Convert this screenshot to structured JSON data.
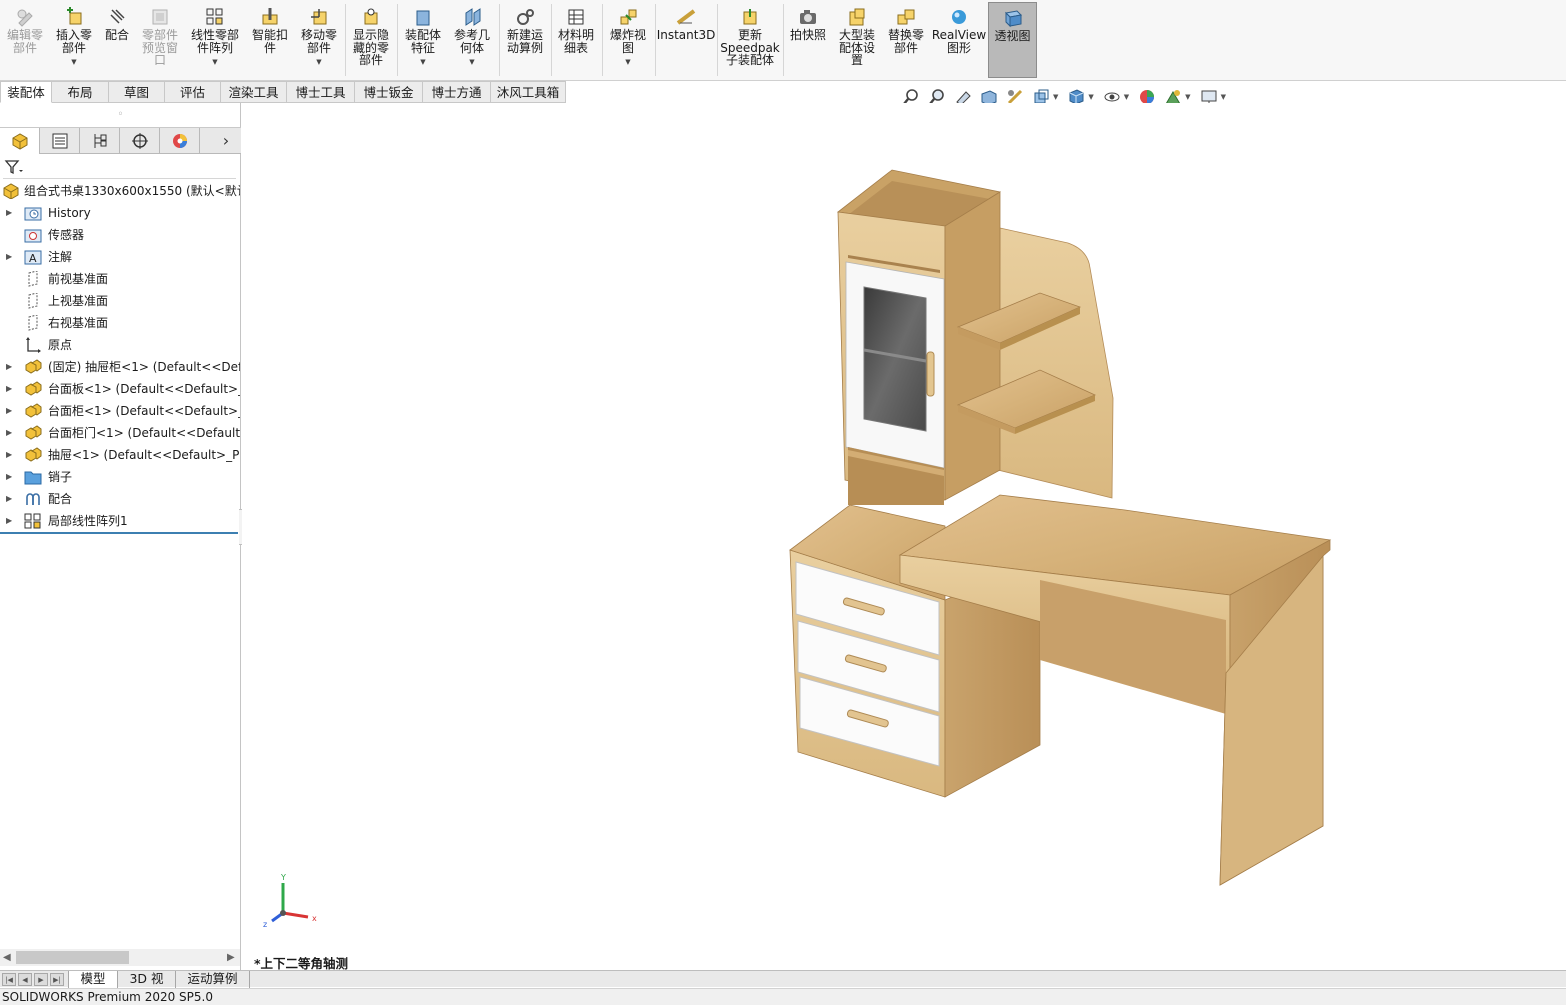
{
  "ribbon": {
    "items": [
      {
        "label": "编辑零\n部件",
        "icon": "edit-component-icon",
        "disabled": true
      },
      {
        "label": "插入零\n部件",
        "icon": "insert-components-icon",
        "dropdown": true
      },
      {
        "label": "配合",
        "icon": "mate-icon"
      },
      {
        "label": "零部件\n预览窗\n口",
        "icon": "component-preview-icon",
        "disabled": true
      },
      {
        "label": "线性零部\n件阵列",
        "icon": "linear-pattern-icon",
        "dropdown": true
      },
      {
        "label": "智能扣\n件",
        "icon": "smart-fasteners-icon"
      },
      {
        "label": "移动零\n部件",
        "icon": "move-component-icon",
        "dropdown": true
      },
      {
        "label": "显示隐\n藏的零\n部件",
        "icon": "show-hidden-icon"
      },
      {
        "label": "装配体\n特征",
        "icon": "assembly-features-icon",
        "dropdown": true
      },
      {
        "label": "参考几\n何体",
        "icon": "reference-geometry-icon",
        "dropdown": true
      },
      {
        "label": "新建运\n动算例",
        "icon": "new-motion-study-icon"
      },
      {
        "label": "材料明\n细表",
        "icon": "bom-icon"
      },
      {
        "label": "爆炸视\n图",
        "icon": "exploded-view-icon",
        "dropdown": true
      },
      {
        "label": "Instant3D",
        "icon": "instant3d-icon"
      },
      {
        "label": "更新\nSpeedpak\n子装配体",
        "icon": "speedpak-icon"
      },
      {
        "label": "拍快照",
        "icon": "snapshot-icon"
      },
      {
        "label": "大型装\n配体设\n置",
        "icon": "large-assembly-icon"
      },
      {
        "label": "替换零\n部件",
        "icon": "replace-components-icon"
      },
      {
        "label": "RealView\n图形",
        "icon": "realview-icon"
      },
      {
        "label": "透视图",
        "icon": "perspective-icon",
        "active": true
      }
    ]
  },
  "tabs": [
    "装配体",
    "布局",
    "草图",
    "评估",
    "渲染工具",
    "博士工具",
    "博士钣金",
    "博士方通",
    "沐风工具箱"
  ],
  "tree": {
    "root": "组合式书桌1330x600x1550  (默认<默认",
    "nodes": [
      {
        "label": "History",
        "icon": "history-folder-icon",
        "expand": true
      },
      {
        "label": "传感器",
        "icon": "sensors-icon",
        "expand": false
      },
      {
        "label": "注解",
        "icon": "annotations-icon",
        "expand": true
      },
      {
        "label": "前视基准面",
        "icon": "plane-icon",
        "expand": false
      },
      {
        "label": "上视基准面",
        "icon": "plane-icon",
        "expand": false
      },
      {
        "label": "右视基准面",
        "icon": "plane-icon",
        "expand": false
      },
      {
        "label": "原点",
        "icon": "origin-icon",
        "expand": false
      },
      {
        "label": "(固定) 抽屉柜<1> (Default<<Defa",
        "icon": "subassembly-icon",
        "expand": true
      },
      {
        "label": "台面板<1> (Default<<Default>_P",
        "icon": "subassembly-icon",
        "expand": true
      },
      {
        "label": "台面柜<1> (Default<<Default>_P",
        "icon": "subassembly-icon",
        "expand": true
      },
      {
        "label": "台面柜门<1> (Default<<Default>",
        "icon": "subassembly-icon",
        "expand": true
      },
      {
        "label": "抽屉<1> (Default<<Default>_Pho",
        "icon": "subassembly-icon",
        "expand": true
      },
      {
        "label": "销子",
        "icon": "folder-icon",
        "expand": true
      },
      {
        "label": "配合",
        "icon": "mates-icon",
        "expand": true
      },
      {
        "label": "局部线性阵列1",
        "icon": "local-pattern-icon",
        "expand": true
      }
    ]
  },
  "viewport": {
    "view_label": "*上下二等角轴测",
    "triad": {
      "x": "x",
      "y": "Y",
      "z": "z"
    }
  },
  "bottom_tabs": [
    "模型",
    "3D 视图",
    "运动算例 1"
  ],
  "status": "SOLIDWORKS Premium 2020 SP5.0",
  "colors": {
    "wood": "#d9b784",
    "wood_dark": "#b78e55",
    "drawer_white": "#fbfbfb",
    "accent": "#3c7fb1"
  }
}
